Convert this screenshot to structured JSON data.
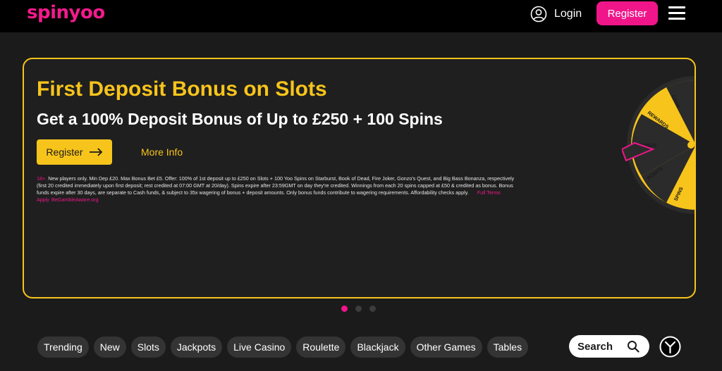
{
  "header": {
    "logo": "spinyoo",
    "login_label": "Login",
    "register_label": "Register"
  },
  "banner": {
    "title": "First Deposit Bonus on Slots",
    "subtitle": "Get a 100% Deposit Bonus of Up to £250 + 100 Spins",
    "register_label": "Register",
    "more_info_label": "More Info",
    "terms_age": "18+.",
    "terms_text": "New players only. Min Dep £20. Max Bonus Bet £5. Offer: 100% of 1st deposit up to £250 on Slots + 100 Yoo Spins on Starburst, Book of Dead, Fire Joker, Gonzo's Quest, and Big Bass Bonanza, respectively (first 20 credited immediately upon first deposit; rest credited at 07:00 GMT at 20/day). Spins expire after 23:59GMT on day they're credited. Winnings from each 20 spins capped at £50 & credited as bonus. Bonus funds expire after 30 days, are separate to Cash funds, & subject to 35x wagering of bonus + deposit amounts. Only bonus funds contribute to wagering requirements. Affordability checks apply.",
    "terms_link_full": "Full Terms Apply",
    "terms_link_gamble": "BeGambleAware.org",
    "wheel_labels": [
      "CASH",
      "REWARDS",
      "BONUS",
      "POINTS",
      "SPINS"
    ]
  },
  "carousel": {
    "active_slide": 1,
    "total_slides": 3
  },
  "categories": [
    "Trending",
    "New",
    "Slots",
    "Jackpots",
    "Live Casino",
    "Roulette",
    "Blackjack",
    "Other Games",
    "Tables"
  ],
  "search": {
    "label": "Search"
  },
  "colors": {
    "brand_pink": "#f0168a",
    "accent_yellow": "#f7c41b",
    "background": "#1b1b1b",
    "header": "#000000"
  }
}
